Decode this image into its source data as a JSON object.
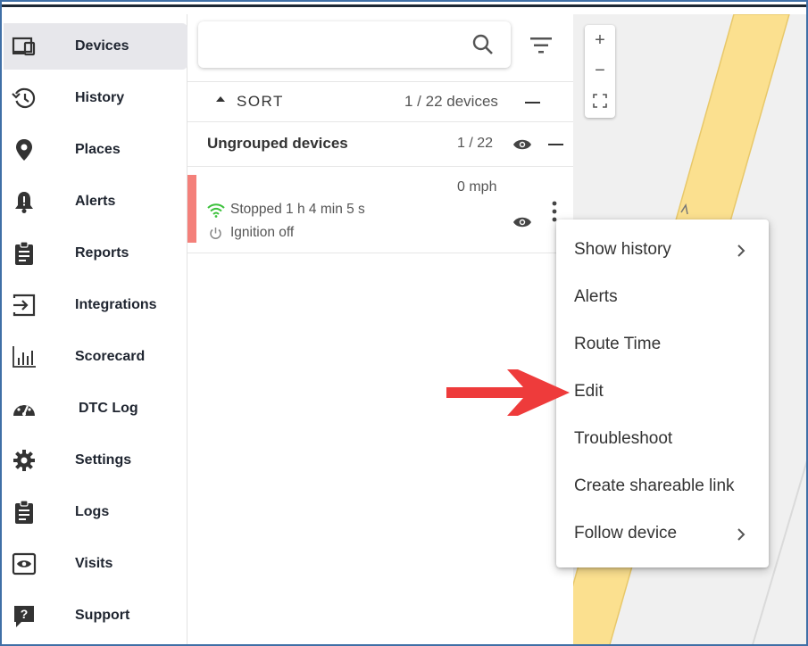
{
  "sidebar": {
    "items": [
      {
        "label": "Devices",
        "icon": "devices-icon",
        "active": true
      },
      {
        "label": "History",
        "icon": "history-icon"
      },
      {
        "label": "Places",
        "icon": "place-pin-icon"
      },
      {
        "label": "Alerts",
        "icon": "alert-bell-icon"
      },
      {
        "label": "Reports",
        "icon": "clipboard-icon"
      },
      {
        "label": "Integrations",
        "icon": "login-icon"
      },
      {
        "label": "Scorecard",
        "icon": "bar-chart-icon"
      },
      {
        "label": "DTC Log",
        "icon": "gauge-icon"
      },
      {
        "label": "Settings",
        "icon": "gear-icon"
      },
      {
        "label": "Logs",
        "icon": "clipboard-icon"
      },
      {
        "label": "Visits",
        "icon": "eye-box-icon"
      },
      {
        "label": "Support",
        "icon": "help-icon"
      }
    ]
  },
  "search": {
    "placeholder": "",
    "value": ""
  },
  "sort": {
    "label": "SORT",
    "count": "1 / 22 devices"
  },
  "group": {
    "title": "Ungrouped devices",
    "count": "1 / 22"
  },
  "device": {
    "speed": "0 mph",
    "status": "Stopped 1 h 4 min 5 s",
    "ignition": "Ignition off",
    "status_color": "#f4807a"
  },
  "map": {
    "zoom_in": "+",
    "zoom_out": "−"
  },
  "menu": {
    "items": [
      {
        "label": "Show history",
        "submenu": true
      },
      {
        "label": "Alerts",
        "submenu": false
      },
      {
        "label": "Route Time",
        "submenu": false
      },
      {
        "label": "Edit",
        "submenu": false
      },
      {
        "label": "Troubleshoot",
        "submenu": false
      },
      {
        "label": "Create shareable link",
        "submenu": false
      },
      {
        "label": "Follow device",
        "submenu": true
      }
    ]
  },
  "colors": {
    "accent_arrow": "#ee3b3b",
    "map_road": "#fbe08f",
    "active_bg": "#e7e7eb"
  }
}
